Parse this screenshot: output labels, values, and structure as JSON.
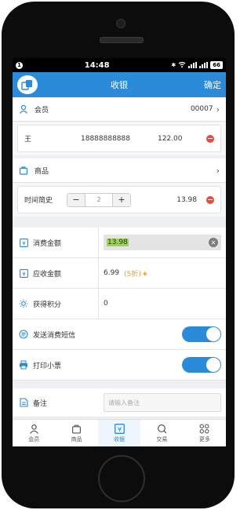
{
  "status_bar": {
    "notification": "1",
    "time": "14:48",
    "battery": "66"
  },
  "nav": {
    "title": "收银",
    "confirm": "确定"
  },
  "member": {
    "label": "会员",
    "id": "00007",
    "name": "王",
    "phone": "18888888888",
    "amount": "122.00"
  },
  "goods": {
    "label": "商品",
    "item_name": "时间简史",
    "minus": "−",
    "plus": "+",
    "quantity": "2",
    "price": "13.98"
  },
  "fields": {
    "consume_label": "消费金额",
    "consume_value": "13.98",
    "receivable_label": "应收金额",
    "receivable_value": "6.99",
    "discount": "(5折)",
    "points_label": "获得积分",
    "points_value": "0",
    "sms_label": "发送消费短信",
    "sms_on": true,
    "print_label": "打印小票",
    "print_on": true,
    "remark_label": "备注",
    "remark_placeholder": "请输入备注"
  },
  "tabs": [
    {
      "label": "会员",
      "icon": "person-icon",
      "active": false
    },
    {
      "label": "商品",
      "icon": "bag-icon",
      "active": false
    },
    {
      "label": "收银",
      "icon": "yen-icon",
      "active": true
    },
    {
      "label": "交易",
      "icon": "search-icon",
      "active": false
    },
    {
      "label": "更多",
      "icon": "grid-icon",
      "active": false
    }
  ],
  "colors": {
    "primary": "#2b8bd8",
    "danger": "#e64c3c",
    "discount": "#f29a1c",
    "selection": "#9ed15a"
  }
}
